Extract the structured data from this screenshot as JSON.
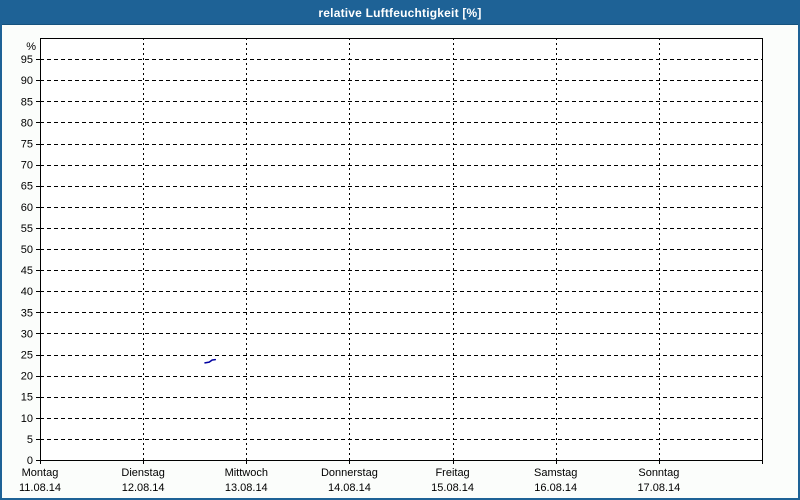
{
  "window": {
    "title": "relative Luftfeuchtigkeit [%]"
  },
  "colors": {
    "frame": "#1e6296",
    "title_text": "#ffffff",
    "outer_bg": "#fbfdfb",
    "plot_bg": "#ffffff",
    "plot_border": "#000000",
    "grid": "#000000",
    "text": "#000000",
    "series_line": "#0000a0"
  },
  "chart_data": {
    "type": "line",
    "title": "relative Luftfeuchtigkeit [%]",
    "xlabel": "",
    "ylabel": "%",
    "ylim": [
      0,
      100
    ],
    "yticks": [
      0,
      5,
      10,
      15,
      20,
      25,
      30,
      35,
      40,
      45,
      50,
      55,
      60,
      65,
      70,
      75,
      80,
      85,
      90,
      95
    ],
    "grid": true,
    "grid_style": "dashed",
    "legend_position": "none",
    "x_categories": [
      {
        "name": "Montag",
        "date": "11.08.14"
      },
      {
        "name": "Dienstag",
        "date": "12.08.14"
      },
      {
        "name": "Mittwoch",
        "date": "13.08.14"
      },
      {
        "name": "Donnerstag",
        "date": "14.08.14"
      },
      {
        "name": "Freitag",
        "date": "15.08.14"
      },
      {
        "name": "Samstag",
        "date": "16.08.14"
      },
      {
        "name": "Sonntag",
        "date": "17.08.14"
      }
    ],
    "x_range_days": [
      0,
      7
    ],
    "series": [
      {
        "name": "relative Luftfeuchtigkeit",
        "color": "#0000a0",
        "points": [
          {
            "day": 1.6,
            "value": 23.0
          },
          {
            "day": 1.64,
            "value": 23.2
          },
          {
            "day": 1.67,
            "value": 23.7
          },
          {
            "day": 1.7,
            "value": 23.8
          }
        ]
      }
    ]
  }
}
